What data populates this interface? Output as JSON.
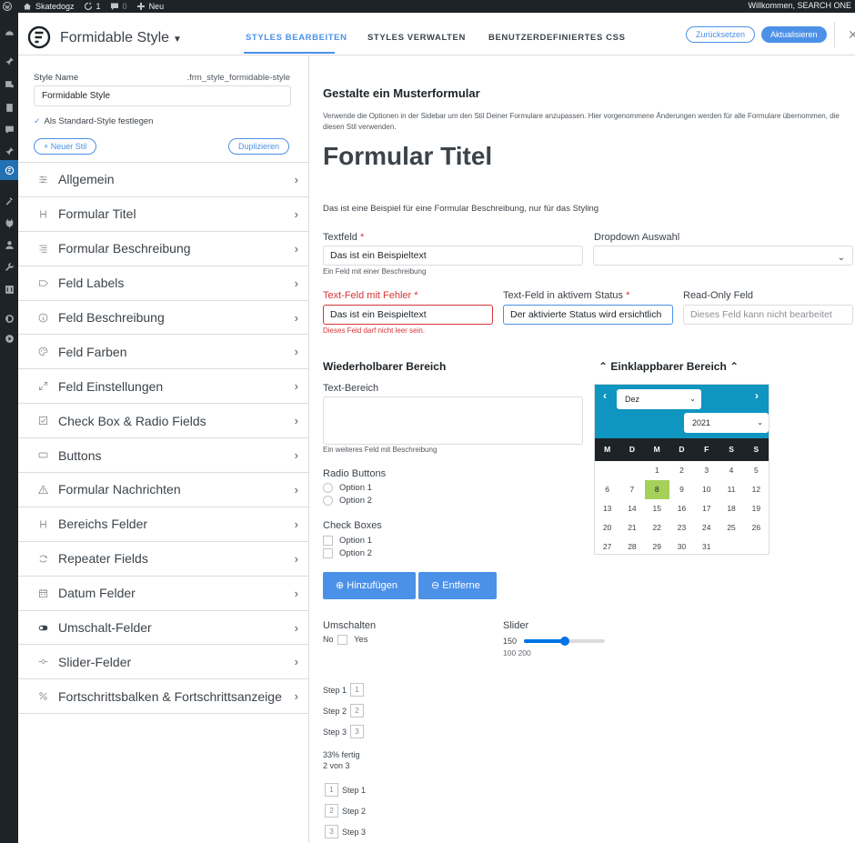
{
  "adminbar": {
    "site_name": "Skatedogz",
    "updates_count": "1",
    "comments_count": "0",
    "new_label": "Neu",
    "welcome": "Willkommen, SEARCH ONE"
  },
  "header": {
    "title": "Formidable Style",
    "tabs": [
      {
        "label": "STYLES BEARBEITEN"
      },
      {
        "label": "STYLES VERWALTEN"
      },
      {
        "label": "BENUTZERDEFINIERTES CSS"
      }
    ],
    "reset_label": "Zurücksetzen",
    "update_label": "Aktualisieren"
  },
  "sidebar": {
    "style_name_label": "Style Name",
    "style_class": ".frm_style_formidable-style",
    "style_name_value": "Formidable Style",
    "default_label": "Als Standard-Style festlegen",
    "new_style_label": "+ Neuer Stil",
    "duplicate_label": "Duplizieren",
    "sections": [
      {
        "label": "Allgemein",
        "icon": "sliders-icon"
      },
      {
        "label": "Formular Titel",
        "icon": "heading-icon"
      },
      {
        "label": "Formular Beschreibung",
        "icon": "align-icon"
      },
      {
        "label": "Feld Labels",
        "icon": "tag-icon"
      },
      {
        "label": "Feld Beschreibung",
        "icon": "info-icon"
      },
      {
        "label": "Feld Farben",
        "icon": "palette-icon"
      },
      {
        "label": "Feld Einstellungen",
        "icon": "expand-icon"
      },
      {
        "label": "Check Box & Radio Fields",
        "icon": "checkbox-icon"
      },
      {
        "label": "Buttons",
        "icon": "button-icon"
      },
      {
        "label": "Formular Nachrichten",
        "icon": "warning-icon"
      },
      {
        "label": "Bereichs Felder",
        "icon": "heading-icon"
      },
      {
        "label": "Repeater Fields",
        "icon": "repeat-icon"
      },
      {
        "label": "Datum Felder",
        "icon": "calendar-icon"
      },
      {
        "label": "Umschalt-Felder",
        "icon": "toggle-icon"
      },
      {
        "label": "Slider-Felder",
        "icon": "slider-icon"
      },
      {
        "label": "Fortschrittsbalken & Fortschrittsanzeige",
        "icon": "percent-icon"
      }
    ]
  },
  "main": {
    "heading": "Gestalte ein Musterformular",
    "description": "Verwende die Optionen in der Sidebar um den Stil Deiner Formulare anzupassen. Hier vorgenommene Änderungen werden für alle Formulare übernommen, die diesen Stil verwenden.",
    "form_title": "Formular Titel",
    "form_description": "Das ist eine Beispiel für eine Formular Beschreibung, nur für das Styling",
    "textfield": {
      "label": "Textfeld",
      "value": "Das ist ein Beispieltext",
      "hint": "Ein Feld mit einer Beschreibung"
    },
    "dropdown": {
      "label": "Dropdown Auswahl"
    },
    "error_field": {
      "label": "Text-Feld mit Fehler",
      "value": "Das ist ein Beispieltext",
      "hint": "Dieses Feld darf nicht leer sein."
    },
    "active_field": {
      "label": "Text-Feld in aktivem Status",
      "value": "Der aktivierte Status wird ersichtlich"
    },
    "readonly_field": {
      "label": "Read-Only Feld",
      "value": "Dieses Feld kann nicht bearbeitet"
    },
    "repeat_title": "Wiederholbarer Bereich",
    "collapse_title": "Einklappbarer Bereich",
    "textarea_label": "Text-Bereich",
    "textarea_hint": "Ein weiteres Feld mit Beschreibung",
    "radio_label": "Radio Buttons",
    "radio_options": [
      "Option 1",
      "Option 2"
    ],
    "check_label": "Check Boxes",
    "check_options": [
      "Option 1",
      "Option 2"
    ],
    "add_button": "Hinzufügen",
    "remove_button": "Entferne",
    "toggle_label": "Umschalten",
    "toggle_no": "No",
    "toggle_yes": "Yes",
    "slider_label": "Slider",
    "slider_value": "150",
    "slider_min": "100",
    "slider_max": "200",
    "slider_fraction": 0.5,
    "steps": [
      "Step 1",
      "Step 2",
      "Step 3"
    ],
    "step_numbers": [
      "1",
      "2",
      "3"
    ],
    "progress_text": "33% fertig",
    "progress_count": "2 von 3"
  },
  "calendar": {
    "month": "Dez",
    "year": "2021",
    "weekdays": [
      "M",
      "D",
      "M",
      "D",
      "F",
      "S",
      "S"
    ],
    "weeks": [
      [
        "",
        "",
        "1",
        "2",
        "3",
        "4",
        "5"
      ],
      [
        "6",
        "7",
        "8",
        "9",
        "10",
        "11",
        "12"
      ],
      [
        "13",
        "14",
        "15",
        "16",
        "17",
        "18",
        "19"
      ],
      [
        "20",
        "21",
        "22",
        "23",
        "24",
        "25",
        "26"
      ],
      [
        "27",
        "28",
        "29",
        "30",
        "31",
        "",
        ""
      ]
    ],
    "today": "8"
  },
  "colors": {
    "accent": "#4b91e8",
    "error": "#d63638",
    "calendar_header": "#0e95c0",
    "today": "#a5d05a"
  }
}
